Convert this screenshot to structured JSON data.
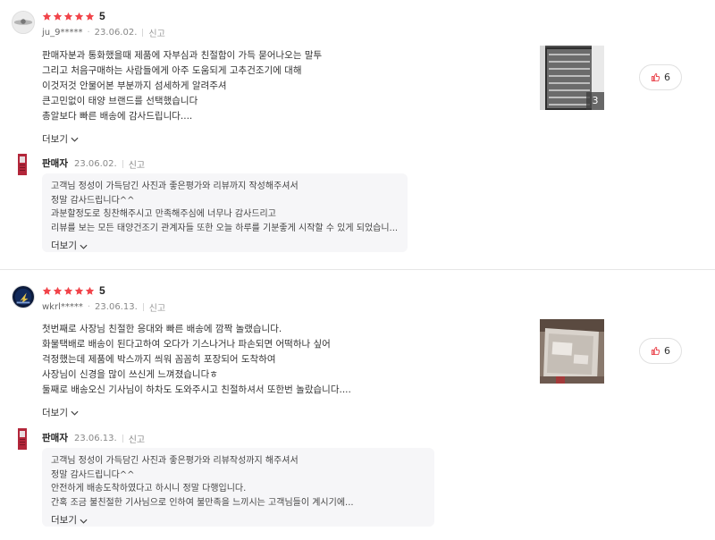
{
  "colors": {
    "star": "#f1444a",
    "like_icon": "#e8333c",
    "reply_bg": "#f6f6f8"
  },
  "reviews": [
    {
      "rating": "5",
      "stars": 5,
      "username": "ju_9*****",
      "date": "23.06.02.",
      "report_label": "신고",
      "body": [
        "판매자분과 통화했을때 제품에 자부심과 친절함이 가득 묻어나오는 말투",
        "그리고 처음구매하는 사람들에게 아주 도움되게 고추건조기에 대해",
        "이것저것 안물어본 부분까지 섬세하게 알려주셔",
        "큰고민없이 태양 브랜드를 선택했습니다",
        "총알보다 빠른 배송에 감사드립니다...."
      ],
      "more_label": "더보기",
      "photo_count": "3",
      "like_count": "6",
      "reply": {
        "seller_label": "판매자",
        "date": "23.06.02.",
        "report_label": "신고",
        "lines": [
          "고객님 정성이 가득담긴 사진과 좋은평가와 리뷰까지 작성해주셔서",
          "정말 감사드립니다^^",
          "과분할정도로 칭찬해주시고 만족해주심에 너무나 감사드리고",
          "리뷰를 보는 모든 태양건조기 관계자들 또한 오늘 하루를 기분좋게 시작할 수 있게 되었습니..."
        ],
        "more_label": "더보기"
      }
    },
    {
      "rating": "5",
      "stars": 5,
      "username": "wkrl*****",
      "date": "23.06.13.",
      "report_label": "신고",
      "body": [
        "첫번째로 사장님 친절한 응대와 빠른 배송에 깜짝 놀랬습니다.",
        "화물택배로 배송이 된다고하여 오다가 기스나거나 파손되면 어떡하나 싶어",
        "걱정했는데 제품에 박스까지 씌워 꼼꼼히 포장되어 도착하여",
        "사장님이 신경을 많이 쓰신게 느껴졌습니다ㅎ",
        "둘째로 배송오신 기사님이 하차도 도와주시고 친절하셔서 또한번 놀랐습니다...."
      ],
      "more_label": "더보기",
      "photo_count": "",
      "like_count": "6",
      "reply": {
        "seller_label": "판매자",
        "date": "23.06.13.",
        "report_label": "신고",
        "lines": [
          "고객님 정성이 가득담긴 사진과 좋은평가와 리뷰작성까지 해주셔서",
          "정말 감사드립니다^^",
          "안전하게 배송도착하였다고 하시니 정말 다행입니다.",
          "간혹 조금 불친절한 기사님으로 인하여 불만족을 느끼시는 고객님들이 계시기에..."
        ],
        "more_label": "더보기"
      }
    }
  ]
}
